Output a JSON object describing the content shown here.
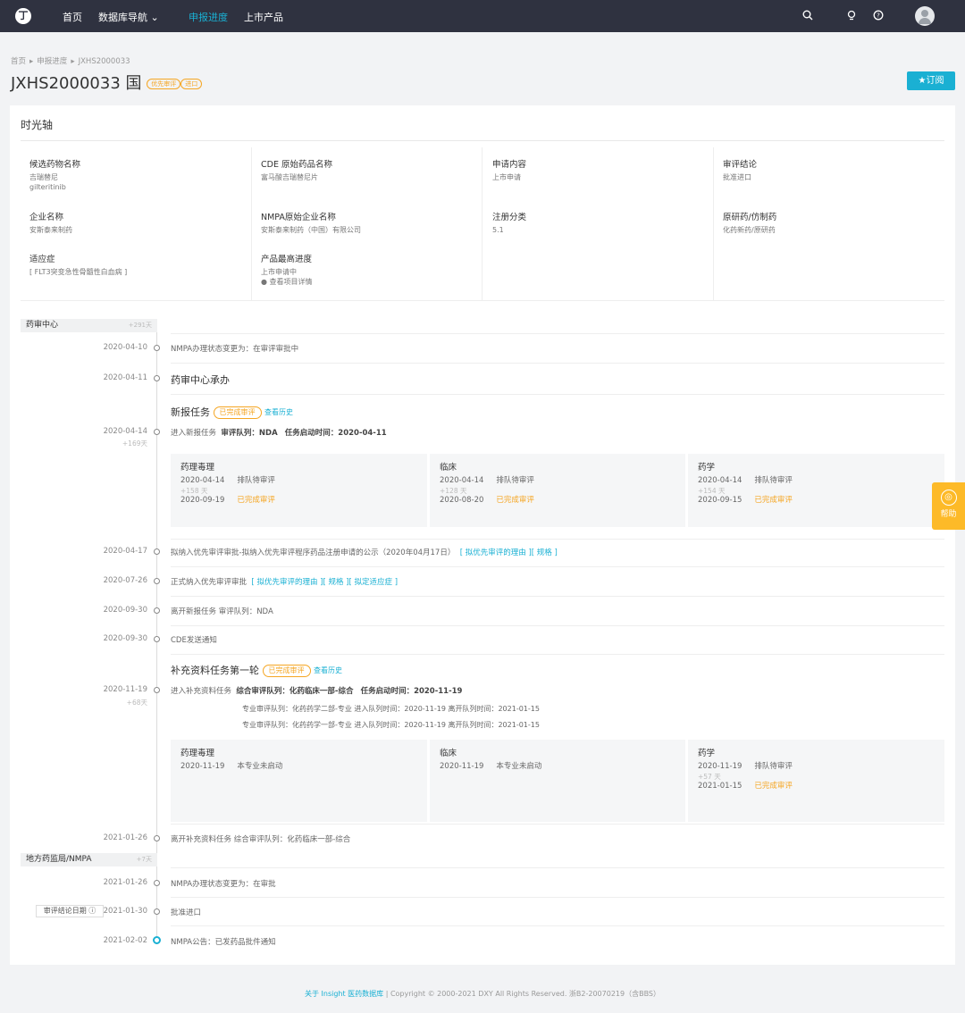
{
  "nav": {
    "logo": "丁",
    "items": [
      "首页",
      "数据库导航 ⌄",
      "申报进度",
      "上市产品"
    ]
  },
  "breadcrumb": [
    "首页",
    "▸",
    "申报进度",
    "▸",
    "JXHS2000033"
  ],
  "header": {
    "title": "JXHS2000033 国",
    "tags": [
      "优先审评",
      "进口"
    ],
    "subscribe": "★订阅"
  },
  "card_title": "时光轴",
  "info": {
    "f1k": "候选药物名称",
    "f1v": "吉瑞替尼",
    "f1v2": "gilteritinib",
    "f2k": "CDE 原始药品名称",
    "f2v": "富马酸吉瑞替尼片",
    "f3k": "申请内容",
    "f3v": "上市申请",
    "f4k": "审评结论",
    "f4v": "批准进口",
    "f5k": "企业名称",
    "f5v": "安斯泰来制药",
    "f6k": "NMPA原始企业名称",
    "f6v": "安斯泰来制药（中国）有限公司",
    "f7k": "注册分类",
    "f7v": "5.1",
    "f8k": "原研药/仿制药",
    "f8v": "化药新药/原研药",
    "f9k": "适应症",
    "f9v": "[ FLT3突变急性骨髓性白血病 ]",
    "f10k": "产品最高进度",
    "f10v": "上市申请中",
    "f10link": "● 查看项目详情"
  },
  "sections": {
    "s1": {
      "label": "药审中心",
      "days": "+291天"
    },
    "s2": {
      "label": "地方药监局/NMPA",
      "days": "+7天"
    }
  },
  "timeline": {
    "e1": {
      "date": "2020-04-10",
      "text": "NMPA办理状态变更为：在审评审批中"
    },
    "e2": {
      "date": "2020-04-11",
      "text": "药审中心承办"
    },
    "task1": {
      "title": "新报任务",
      "badge": "已完成审评",
      "history": "查看历史"
    },
    "e3": {
      "date": "2020-04-14",
      "sub": "+169天",
      "pre": "进入新报任务",
      "b1": "审评队列：NDA",
      "b2": "任务启动时间：2020-04-11"
    },
    "e4": {
      "date": "2020-04-17",
      "text": "拟纳入优先审评审批-拟纳入优先审评程序药品注册申请的公示（2020年04月17日）",
      "links": "[ 拟优先审评的理由 ][ 规格 ]"
    },
    "e5": {
      "date": "2020-07-26",
      "text": "正式纳入优先审评审批",
      "links": "[ 拟优先审评的理由 ][ 规格 ][ 拟定适应症 ]"
    },
    "e6": {
      "date": "2020-09-30",
      "text": "离开新报任务  审评队列：NDA"
    },
    "e7": {
      "date": "2020-09-30",
      "text": "CDE发送通知"
    },
    "task2": {
      "title": "补充资料任务第一轮",
      "badge": "已完成审评",
      "history": "查看历史"
    },
    "e8": {
      "date": "2020-11-19",
      "sub": "+68天",
      "pre": "进入补充资料任务",
      "b1": "综合审评队列：化药临床一部-综合",
      "b2": "任务启动时间：2020-11-19",
      "l2": "专业审评队列：化药药学二部-专业  进入队列时间：2020-11-19  离开队列时间：2021-01-15",
      "l3": "专业审评队列：化药药学一部-专业  进入队列时间：2020-11-19  离开队列时间：2021-01-15"
    },
    "e9": {
      "date": "2021-01-26",
      "text": "离开补充资料任务  综合审评队列：化药临床一部-综合"
    },
    "e10": {
      "date": "2021-01-26",
      "text": "NMPA办理状态变更为：在审批"
    },
    "e11": {
      "date": "2021-01-30",
      "text": "批准进口",
      "qlabel": "审评结论日期 ⓘ"
    },
    "e12": {
      "date": "2021-02-02",
      "text": "NMPA公告：已发药品批件通知"
    }
  },
  "boxes1": {
    "a": {
      "title": "药理毒理",
      "d1": "2020-04-14",
      "s1": "排队待审评",
      "plus": "+158 天",
      "d2": "2020-09-19",
      "s2": "已完成审评"
    },
    "b": {
      "title": "临床",
      "d1": "2020-04-14",
      "s1": "排队待审评",
      "plus": "+128 天",
      "d2": "2020-08-20",
      "s2": "已完成审评"
    },
    "c": {
      "title": "药学",
      "d1": "2020-04-14",
      "s1": "排队待审评",
      "plus": "+154 天",
      "d2": "2020-09-15",
      "s2": "已完成审评"
    }
  },
  "boxes2": {
    "a": {
      "title": "药理毒理",
      "d1": "2020-11-19",
      "s1": "本专业未启动"
    },
    "b": {
      "title": "临床",
      "d1": "2020-11-19",
      "s1": "本专业未启动"
    },
    "c": {
      "title": "药学",
      "d1": "2020-11-19",
      "s1": "排队待审评",
      "plus": "+57 天",
      "d2": "2021-01-15",
      "s2": "已完成审评"
    }
  },
  "help": {
    "icon": "◎",
    "label": "帮助"
  },
  "footer": {
    "link": "关于 Insight 医药数据库",
    "text": " | Copyright © 2000-2021 DXY All Rights Reserved. 浙B2-20070219（含BBS）"
  },
  "colors": {
    "accent": "#1ab0d3",
    "orange": "#f5a623",
    "nav_bg": "#2f3240"
  }
}
